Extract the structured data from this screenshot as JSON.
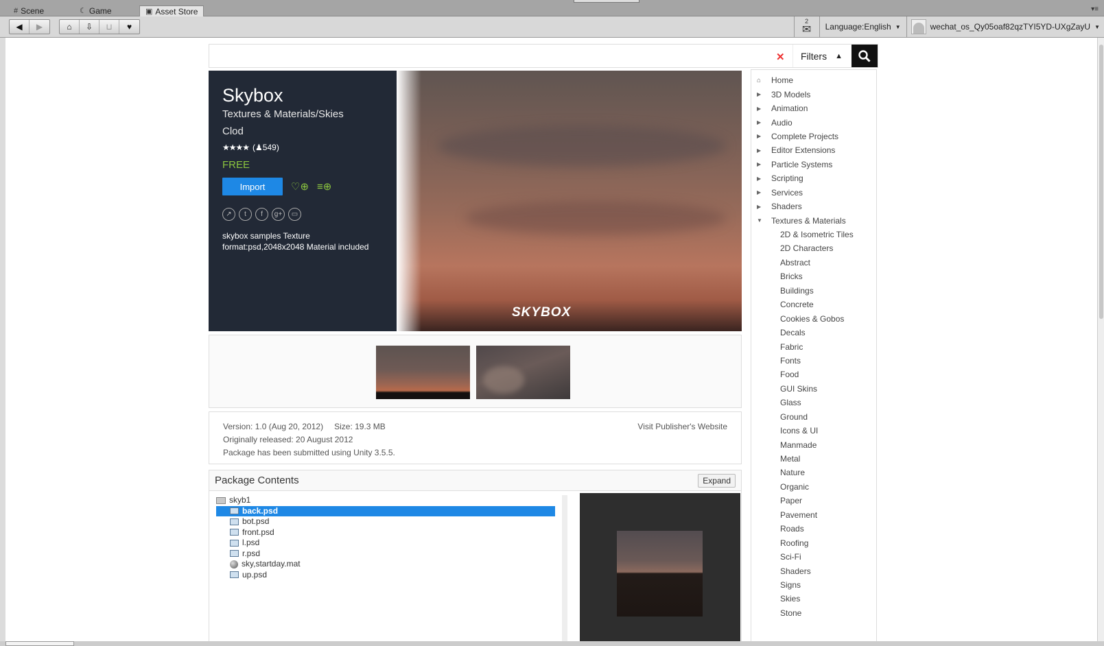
{
  "tabs": [
    {
      "label": "Scene",
      "icon": "grid-icon"
    },
    {
      "label": "Game",
      "icon": "pacman-icon"
    },
    {
      "label": "Asset Store",
      "icon": "bag-icon"
    }
  ],
  "toolbar": {
    "mail_count": "2",
    "language": "Language:English",
    "user": "wechat_os_Qy05oaf82qzTYI5YD-UXgZayU"
  },
  "search": {
    "value": "",
    "filters_label": "Filters"
  },
  "asset": {
    "title": "Skybox",
    "category": "Textures & Materials/Skies",
    "publisher": "Clod",
    "stars": "★★★★",
    "rating_count": "549",
    "price": "FREE",
    "import_label": "Import",
    "description": "skybox samples Texture format:psd,2048x2048 Material included",
    "banner_text": "SKYBOX"
  },
  "info": {
    "version": "Version: 1.0 (Aug 20, 2012)",
    "size": "Size: 19.3 MB",
    "released": "Originally released: 20 August 2012",
    "unity": "Package has been submitted using Unity 3.5.5.",
    "visit": "Visit Publisher's Website"
  },
  "package": {
    "title": "Package Contents",
    "expand_label": "Expand",
    "folder": "skyb1",
    "files": [
      {
        "name": "back.psd",
        "selected": true,
        "kind": "texture"
      },
      {
        "name": "bot.psd",
        "kind": "texture"
      },
      {
        "name": "front.psd",
        "kind": "texture"
      },
      {
        "name": "l.psd",
        "kind": "texture"
      },
      {
        "name": "r.psd",
        "kind": "texture"
      },
      {
        "name": "sky,startday.mat",
        "kind": "material"
      },
      {
        "name": "up.psd",
        "kind": "texture"
      }
    ]
  },
  "sidebar": {
    "categories": [
      "Home",
      "3D Models",
      "Animation",
      "Audio",
      "Complete Projects",
      "Editor Extensions",
      "Particle Systems",
      "Scripting",
      "Services",
      "Shaders",
      "Textures & Materials"
    ],
    "subcategories": [
      "2D & Isometric Tiles",
      "2D Characters",
      "Abstract",
      "Bricks",
      "Buildings",
      "Concrete",
      "Cookies & Gobos",
      "Decals",
      "Fabric",
      "Fonts",
      "Food",
      "GUI Skins",
      "Glass",
      "Ground",
      "Icons & UI",
      "Manmade",
      "Metal",
      "Nature",
      "Organic",
      "Paper",
      "Pavement",
      "Roads",
      "Roofing",
      "Sci-Fi",
      "Shaders",
      "Signs",
      "Skies",
      "Stone"
    ]
  },
  "colors": {
    "accent": "#1e88e5",
    "price": "#8cc63f",
    "hero_bg": "#222936"
  }
}
